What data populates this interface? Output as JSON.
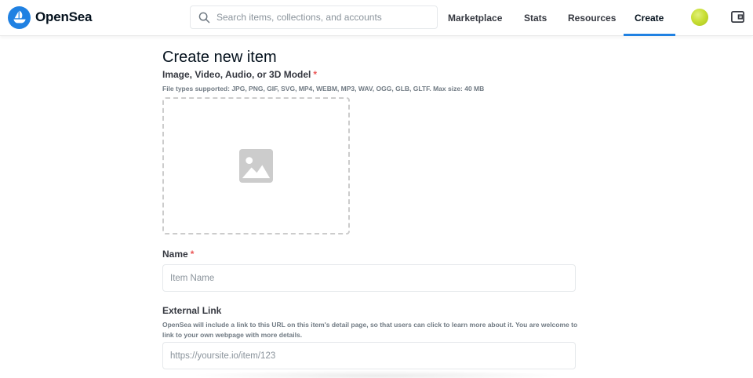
{
  "header": {
    "brand": "OpenSea",
    "search_placeholder": "Search items, collections, and accounts",
    "nav": [
      {
        "label": "Marketplace"
      },
      {
        "label": "Stats"
      },
      {
        "label": "Resources"
      },
      {
        "label": "Create"
      }
    ],
    "active_nav": "Create"
  },
  "form": {
    "title": "Create new item",
    "media_label": "Image, Video, Audio, or 3D Model",
    "required_mark": "*",
    "media_help": "File types supported: JPG, PNG, GIF, SVG, MP4, WEBM, MP3, WAV, OGG, GLB, GLTF. Max size: 40 MB",
    "name_label": "Name",
    "name_placeholder": "Item Name",
    "external_link_label": "External Link",
    "external_link_help": "OpenSea will include a link to this URL on this item's detail page, so that users can click to learn more about it. You are welcome to link to your own webpage with more details.",
    "external_link_placeholder": "https://yoursite.io/item/123"
  },
  "colors": {
    "brand_blue": "#2081e2",
    "required_red": "#eb5757",
    "avatar_green": "#c9df36"
  },
  "icons": [
    "opensea-logo-icon",
    "search-icon",
    "avatar-icon",
    "wallet-icon",
    "image-placeholder-icon"
  ]
}
